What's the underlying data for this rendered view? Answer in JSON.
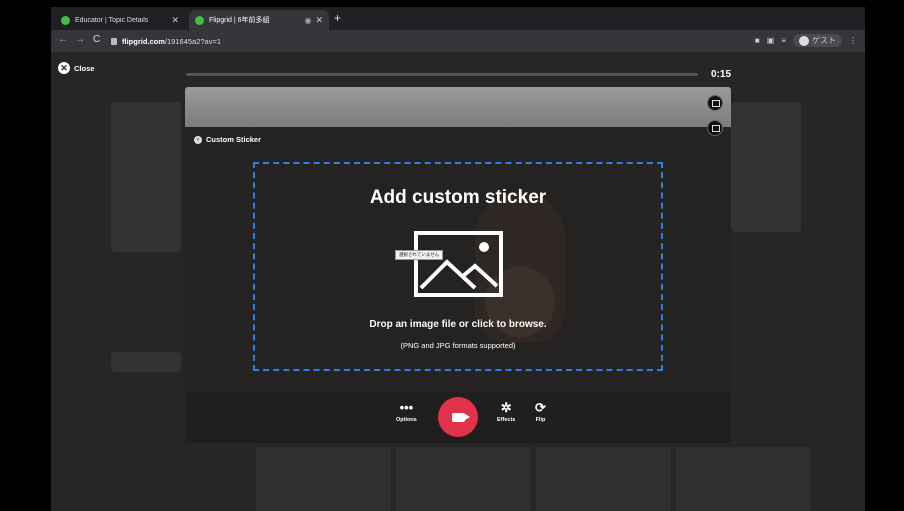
{
  "tabs": [
    {
      "title": "Educator | Topic Details",
      "active": false
    },
    {
      "title": "Flipgrid | 6年前多組",
      "active": true
    }
  ],
  "address": {
    "host": "flipgrid.com",
    "path": "/191645a2?av=1"
  },
  "profile": {
    "label": "ゲスト"
  },
  "close_label": "Close",
  "recording": {
    "progress": 0.0,
    "time": "0:15"
  },
  "sticker": {
    "header": "Custom Sticker",
    "title": "Add custom sticker",
    "tooltip": "選択されていません",
    "message": "Drop an image file or click to browse.",
    "formats": "(PNG and JPG formats supported)"
  },
  "controls": {
    "options_label": "Options",
    "effects_label": "Effects",
    "flip_label": "Flip"
  },
  "colors": {
    "accent_border": "#2d7fe6",
    "record": "#e0324a"
  }
}
